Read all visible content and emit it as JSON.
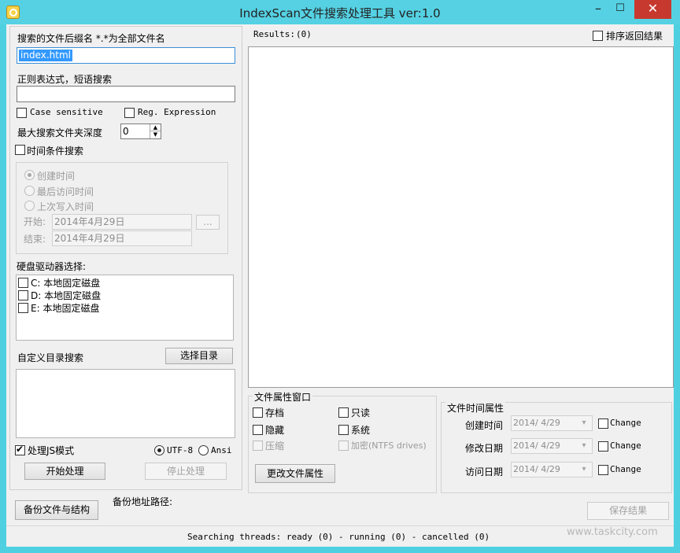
{
  "window": {
    "title": "IndexScan文件搜索处理工具 ver:1.0",
    "minimize_glyph": "–",
    "maximize_glyph": "☐",
    "close_glyph": "✕"
  },
  "left": {
    "suffix_label": "搜索的文件后缀名 *.*为全部文件名",
    "suffix_value": "index.html",
    "regex_label": "正则表达式，短语搜索",
    "regex_value": "",
    "case_sensitive_label": "Case sensitive",
    "reg_expression_label": "Reg. Expression",
    "depth_label": "最大搜索文件夹深度",
    "depth_value": "0",
    "time_search_label": "时间条件搜索",
    "time_options": [
      "创建时间",
      "最后访问时间",
      "上次写入时间"
    ],
    "start_label": "开始:",
    "start_value": "2014年4月29日",
    "ellipsis_label": "...",
    "end_label": "结束:",
    "end_value": "2014年4月29日",
    "drives_label": "硬盘驱动器选择:",
    "drives": [
      "C: 本地固定磁盘",
      "D: 本地固定磁盘",
      "E: 本地固定磁盘"
    ],
    "custom_dir_label": "自定义目录搜索",
    "choose_dir_button": "选择目录",
    "js_mode_label": "处理JS模式",
    "utf8_label": "UTF-8",
    "ansi_label": "Ansi",
    "start_button": "开始处理",
    "stop_button": "停止处理"
  },
  "results": {
    "label": "Results:",
    "count": "(0)",
    "sort_label": "排序返回结果"
  },
  "attributes": {
    "group_title": "文件属性窗口",
    "archive": "存档",
    "readonly": "只读",
    "hidden": "隐藏",
    "system": "系统",
    "compressed": "压缩",
    "encrypted": "加密(NTFS drives)",
    "change_attr_button": "更改文件属性"
  },
  "time_attrs": {
    "group_title": "文件时间属性",
    "rows": [
      {
        "label": "创建时间",
        "value": "2014/ 4/29",
        "change": "Change"
      },
      {
        "label": "修改日期",
        "value": "2014/ 4/29",
        "change": "Change"
      },
      {
        "label": "访问日期",
        "value": "2014/ 4/29",
        "change": "Change"
      }
    ]
  },
  "bottom": {
    "backup_button": "备份文件与结构",
    "backup_path_label": "备份地址路径:",
    "save_button": "保存结果",
    "status": "Searching threads: ready (0) - running (0) - cancelled (0)",
    "watermark": "www.taskcity.com"
  }
}
